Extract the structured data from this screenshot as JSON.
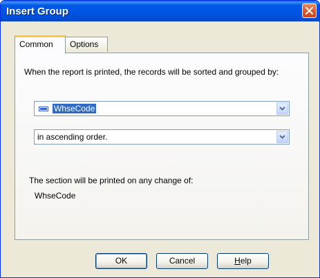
{
  "window": {
    "title": "Insert Group"
  },
  "tabs": [
    {
      "label": "Common"
    },
    {
      "label": "Options"
    }
  ],
  "common": {
    "description": "When the report is printed, the records will be sorted and grouped by:",
    "group_field": {
      "value": "WhseCode",
      "icon": "database-field-icon"
    },
    "sort_order": {
      "value": "in ascending order."
    },
    "section_text": "The section will be printed on any change of:",
    "section_field": "WhseCode"
  },
  "buttons": {
    "ok": "OK",
    "cancel": "Cancel",
    "help_first": "H",
    "help_rest": "elp"
  },
  "colors": {
    "titlebar": "#0055e4",
    "dialog_bg": "#ece9d8",
    "active_tab_accent": "#ffc83c",
    "selection": "#316ac5",
    "close_button": "#d95b2f"
  }
}
